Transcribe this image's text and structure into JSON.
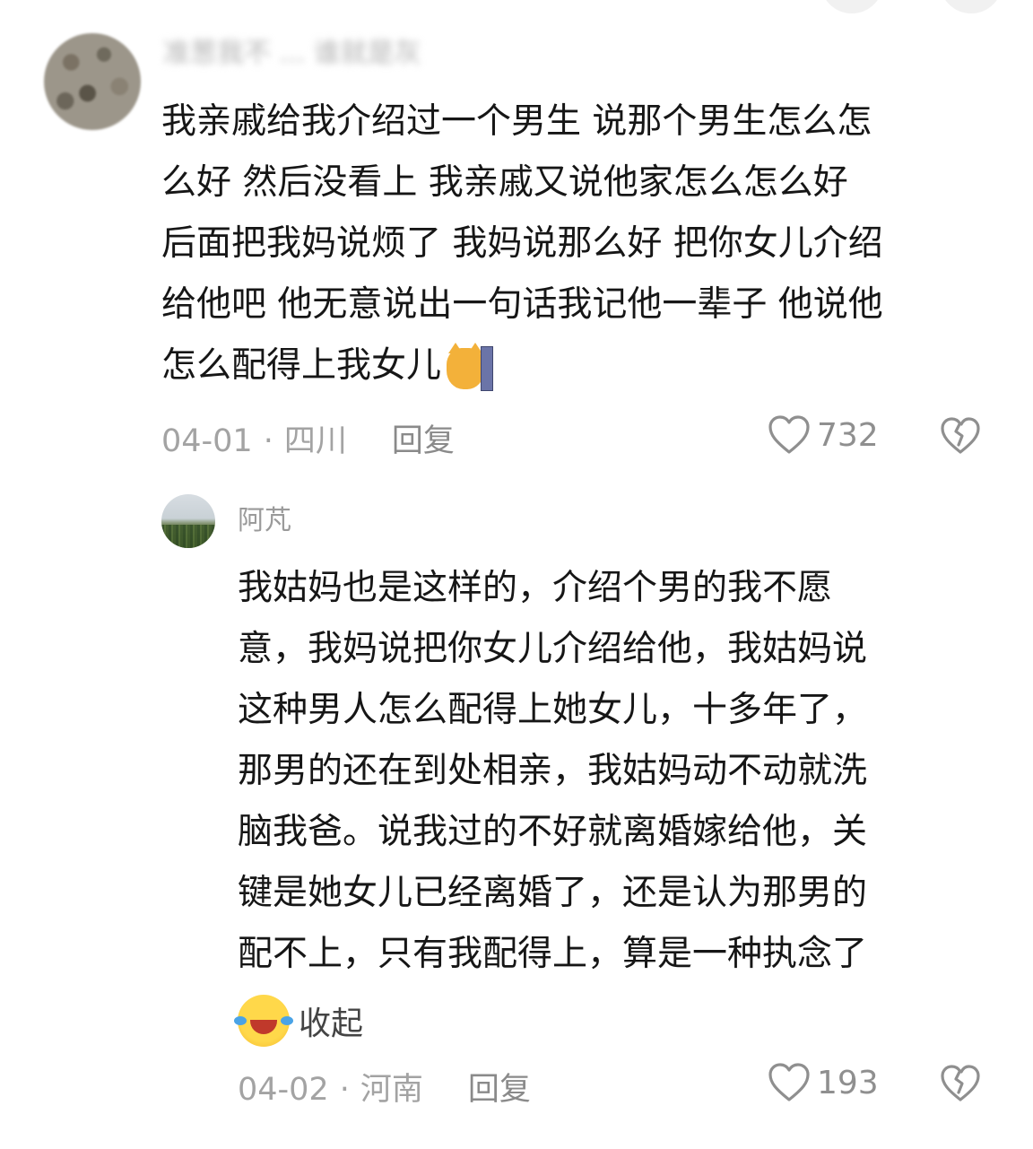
{
  "main_comment": {
    "username": "准葱我不 ... 谁就是灰",
    "lines": [
      "我亲戚给我介绍过一个男生 说那个男生怎么怎",
      "么好 然后没看上 我亲戚又说他家怎么怎么好",
      "后面把我妈说烦了 我妈说那么好 把你女儿介绍",
      "给他吧 他无意说出一句话我记他一辈子 他说他",
      "怎么配得上我女儿"
    ],
    "emoji": "cat-peeking-wall",
    "date": "04-01",
    "location": "四川",
    "reply_label": "回复",
    "likes": "732"
  },
  "reply_comment": {
    "username": "阿芃",
    "lines": [
      "我姑妈也是这样的，介绍个男的我不愿",
      "意，我妈说把你女儿介绍给他，我姑妈说",
      "这种男人怎么配得上她女儿，十多年了，",
      "那男的还在到处相亲，我姑妈动不动就洗",
      "脑我爸。说我过的不好就离婚嫁给他，关",
      "键是她女儿已经离婚了，还是认为那男的",
      "配不上，只有我配得上，算是一种执念了"
    ],
    "emoji": "laughing-crying",
    "collapse_label": "收起",
    "date": "04-02",
    "location": "河南",
    "reply_label": "回复",
    "likes": "193"
  },
  "separator": "·",
  "colors": {
    "text": "#161616",
    "meta": "#a3a3a3",
    "icon": "#8f8f8f"
  }
}
